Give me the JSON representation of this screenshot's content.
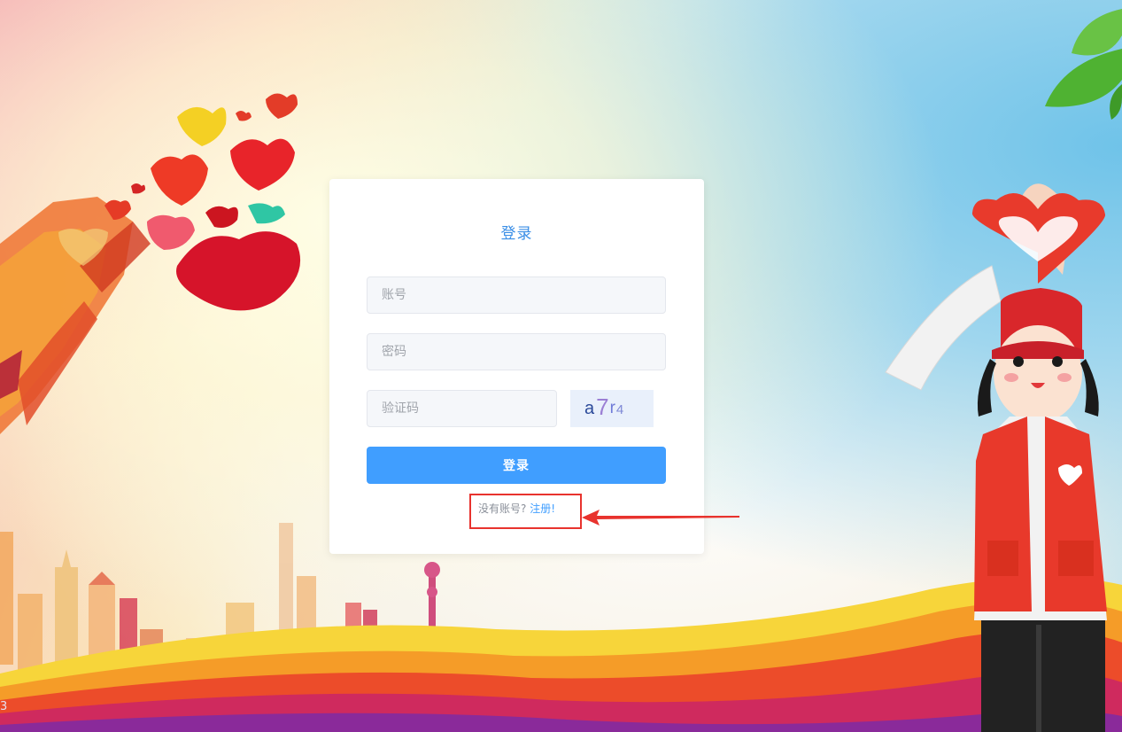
{
  "login": {
    "title": "登录",
    "account_placeholder": "账号",
    "password_placeholder": "密码",
    "captcha_placeholder": "验证码",
    "captcha_chars": [
      "a",
      "7",
      "r",
      "4"
    ],
    "submit_label": "登录",
    "no_account_text": "没有账号?",
    "register_link": "注册!"
  },
  "corner_mark": "3",
  "colors": {
    "accent": "#409eff",
    "title": "#3a8ee6",
    "annotation_red": "#e8332e",
    "captcha_bg": "#e9f0fb"
  }
}
